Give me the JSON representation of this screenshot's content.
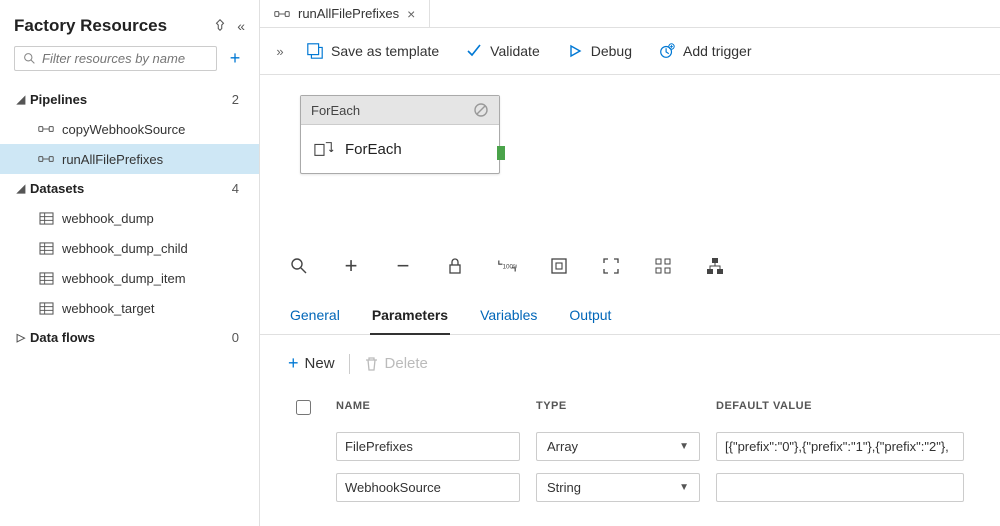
{
  "sidebar": {
    "title": "Factory Resources",
    "filter_placeholder": "Filter resources by name",
    "sections": [
      {
        "label": "Pipelines",
        "count": "2",
        "expanded": true,
        "items": [
          {
            "label": "copyWebhookSource",
            "icon": "pipeline-icon",
            "selected": false
          },
          {
            "label": "runAllFilePrefixes",
            "icon": "pipeline-icon",
            "selected": true
          }
        ]
      },
      {
        "label": "Datasets",
        "count": "4",
        "expanded": true,
        "items": [
          {
            "label": "webhook_dump",
            "icon": "dataset-icon"
          },
          {
            "label": "webhook_dump_child",
            "icon": "dataset-icon"
          },
          {
            "label": "webhook_dump_item",
            "icon": "dataset-icon"
          },
          {
            "label": "webhook_target",
            "icon": "dataset-icon"
          }
        ]
      },
      {
        "label": "Data flows",
        "count": "0",
        "expanded": false,
        "items": []
      }
    ]
  },
  "editor_tab": {
    "label": "runAllFilePrefixes"
  },
  "toolbar": {
    "save_template": "Save as template",
    "validate": "Validate",
    "debug": "Debug",
    "add_trigger": "Add trigger"
  },
  "canvas_node": {
    "type": "ForEach",
    "title": "ForEach"
  },
  "detail_tabs": {
    "general": "General",
    "parameters": "Parameters",
    "variables": "Variables",
    "output": "Output",
    "active_index": 1
  },
  "panel_actions": {
    "new": "New",
    "delete": "Delete"
  },
  "param_table": {
    "headers": {
      "name": "NAME",
      "type": "TYPE",
      "default": "DEFAULT VALUE"
    },
    "rows": [
      {
        "name": "FilePrefixes",
        "type": "Array",
        "default": "[{\"prefix\":\"0\"},{\"prefix\":\"1\"},{\"prefix\":\"2\"},"
      },
      {
        "name": "WebhookSource",
        "type": "String",
        "default": ""
      }
    ]
  }
}
